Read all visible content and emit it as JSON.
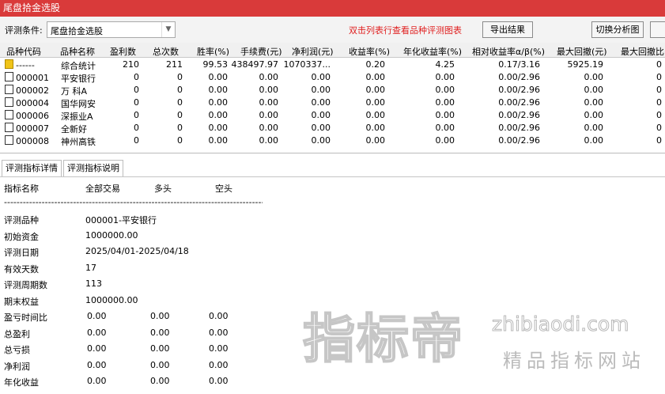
{
  "window": {
    "title": "尾盘拾金选股"
  },
  "toolbar": {
    "condition_label": "评测条件:",
    "condition_value": "尾盘拾金选股",
    "hint": "双击列表行查看品种评测图表",
    "export_label": "导出结果",
    "switch_label": "切换分析图"
  },
  "table": {
    "headers": [
      "品种代码",
      "品种名称",
      "盈利数",
      "总次数",
      "胜率(%)",
      "手续费(元)",
      "净利润(元)",
      "收益率(%)",
      "年化收益率(%)",
      "相对收益率α/β(%)",
      "最大回撤(元)",
      "最大回撤比("
    ],
    "rows": [
      {
        "code": "------",
        "name": "综合统计",
        "win": "210",
        "total": "211",
        "rate": "99.53",
        "fee": "438497.97",
        "profit": "1070337...",
        "ret": "0.20",
        "annual": "4.25",
        "ab": "0.17/3.16",
        "dd": "5925.19",
        "ddr": "0"
      },
      {
        "code": "000001",
        "name": "平安银行",
        "win": "0",
        "total": "0",
        "rate": "0.00",
        "fee": "0.00",
        "profit": "0.00",
        "ret": "0.00",
        "annual": "0.00",
        "ab": "0.00/2.96",
        "dd": "0.00",
        "ddr": "0"
      },
      {
        "code": "000002",
        "name": "万 科A",
        "win": "0",
        "total": "0",
        "rate": "0.00",
        "fee": "0.00",
        "profit": "0.00",
        "ret": "0.00",
        "annual": "0.00",
        "ab": "0.00/2.96",
        "dd": "0.00",
        "ddr": "0"
      },
      {
        "code": "000004",
        "name": "国华网安",
        "win": "0",
        "total": "0",
        "rate": "0.00",
        "fee": "0.00",
        "profit": "0.00",
        "ret": "0.00",
        "annual": "0.00",
        "ab": "0.00/2.96",
        "dd": "0.00",
        "ddr": "0"
      },
      {
        "code": "000006",
        "name": "深振业A",
        "win": "0",
        "total": "0",
        "rate": "0.00",
        "fee": "0.00",
        "profit": "0.00",
        "ret": "0.00",
        "annual": "0.00",
        "ab": "0.00/2.96",
        "dd": "0.00",
        "ddr": "0"
      },
      {
        "code": "000007",
        "name": "全新好",
        "win": "0",
        "total": "0",
        "rate": "0.00",
        "fee": "0.00",
        "profit": "0.00",
        "ret": "0.00",
        "annual": "0.00",
        "ab": "0.00/2.96",
        "dd": "0.00",
        "ddr": "0"
      },
      {
        "code": "000008",
        "name": "神州高铁",
        "win": "0",
        "total": "0",
        "rate": "0.00",
        "fee": "0.00",
        "profit": "0.00",
        "ret": "0.00",
        "annual": "0.00",
        "ab": "0.00/2.96",
        "dd": "0.00",
        "ddr": "0"
      }
    ]
  },
  "tabs": [
    "评测指标详情",
    "评测指标说明"
  ],
  "detail": {
    "col_name": "指标名称",
    "col_all": "全部交易",
    "col_long": "多头",
    "col_short": "空头",
    "separator": "------------------------------------------------------------------------------------------",
    "info": [
      {
        "label": "评测品种",
        "value": "000001-平安银行"
      },
      {
        "label": "初始资金",
        "value": "1000000.00"
      },
      {
        "label": "评测日期",
        "value": "2025/04/01-2025/04/18"
      },
      {
        "label": "有效天数",
        "value": "17"
      },
      {
        "label": "评测周期数",
        "value": "113"
      },
      {
        "label": "期末权益",
        "value": "1000000.00"
      }
    ],
    "stats": [
      {
        "label": "盈亏时间比",
        "all": "0.00",
        "long": "0.00",
        "short": "0.00"
      },
      {
        "label": "总盈利",
        "all": "0.00",
        "long": "0.00",
        "short": "0.00"
      },
      {
        "label": "总亏损",
        "all": "0.00",
        "long": "0.00",
        "short": "0.00"
      },
      {
        "label": "净利润",
        "all": "0.00",
        "long": "0.00",
        "short": "0.00"
      },
      {
        "label": "年化收益",
        "all": "0.00",
        "long": "0.00",
        "short": "0.00"
      }
    ]
  },
  "watermark": {
    "big": "指标帝",
    "domain": "zhibiaodi.com",
    "slogan": "精品指标网站"
  },
  "colors": {
    "titlebar": "#d93a3a",
    "hint": "#e02020"
  }
}
